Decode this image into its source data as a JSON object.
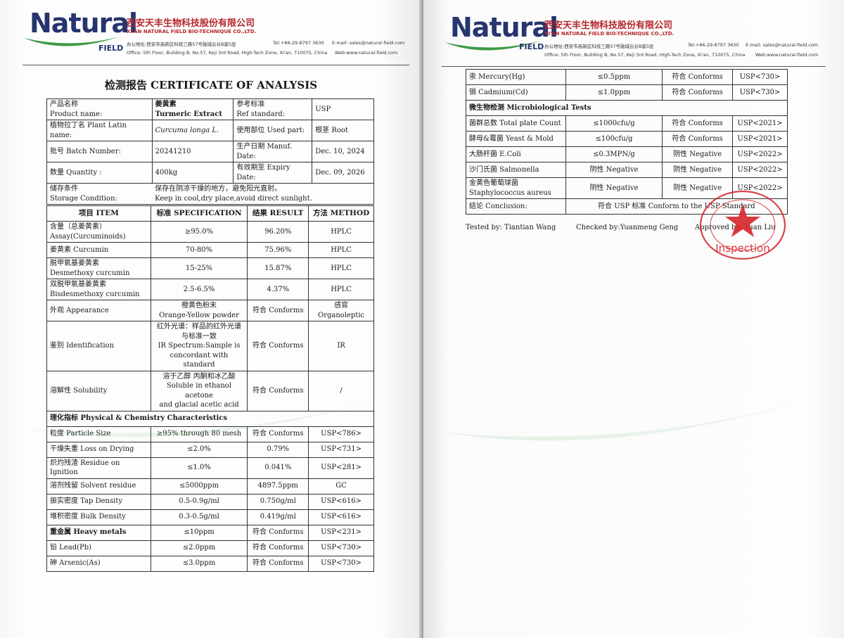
{
  "header": {
    "logo_text": "Natural",
    "logo_sub": "FIELD",
    "company_cn": "西安天丰生物科技股份有限公司",
    "company_en": "XI'AN NATURAL FIELD BIO-TECHNIQUE CO.,LTD.",
    "address_cn": "办公地址:西安市高新区科技三路57号融城云谷B座5层",
    "tel": "Tel:+86-29-8797 3630",
    "email": "E-mail: sales@natural-field.com",
    "address_en": "Office: 5th Floor, Building B, No.57, Keji 3rd Road, High-Tech Zone, Xi'an, 710075, China",
    "web": "Web:www.natural-field.com"
  },
  "title": "检测报告 CERTIFICATE OF ANALYSIS",
  "info": {
    "product_name_cn": "产品名称",
    "product_name_en": "Product name:",
    "product_value_cn": "姜黄素",
    "product_value_en": "Turmeric Extract",
    "ref_cn": "参考标准",
    "ref_en": "Ref standard:",
    "ref_value": "USP",
    "latin_label": "植物拉丁名 Plant Latin name:",
    "latin_value": "Curcuma longa L.",
    "part_label": "使用部位 Used part:",
    "part_value": "根茎 Root",
    "batch_label": "批号 Batch Number:",
    "batch_value": "20241210",
    "manuf_label": "生产日期 Manuf. Date:",
    "manuf_value": "Dec. 10, 2024",
    "qty_label": "数量 Quantity :",
    "qty_value": "400kg",
    "expiry_label": "有效期至 Expiry Date:",
    "expiry_value": "Dec. 09, 2026",
    "storage_cn": "储存条件",
    "storage_en": "Storage Condition:",
    "storage_value_cn": "保存在阴凉干燥的地方，避免阳光直射。",
    "storage_value_en": "Keep in cool,dry place,avoid direct sunlight."
  },
  "results_header": [
    "项目 ITEM",
    "标准 SPECIFICATION",
    "结果 RESULT",
    "方法 METHOD"
  ],
  "results": [
    {
      "item": [
        "含量（总姜黄素）",
        "Assay(Curcuminoids)"
      ],
      "spec": [
        "≥95.0%"
      ],
      "result": "96.20%",
      "method": "HPLC"
    },
    {
      "item": [
        "姜黄素 Curcumin"
      ],
      "spec": [
        "70-80%"
      ],
      "result": "75.96%",
      "method": "HPLC"
    },
    {
      "item": [
        "脱甲氧基姜黄素",
        "Desmethoxy curcumin"
      ],
      "spec": [
        "15-25%"
      ],
      "result": "15.87%",
      "method": "HPLC"
    },
    {
      "item": [
        "双脱甲氧基姜黄素",
        "Bisdesmethoxy curcumin"
      ],
      "spec": [
        "2.5-6.5%"
      ],
      "result": "4.37%",
      "method": "HPLC"
    },
    {
      "item": [
        "外观 Appearance"
      ],
      "spec": [
        "橙黄色粉末",
        "Orange-Yellow powder"
      ],
      "result": "符合 Conforms",
      "method": "感官 Organoleptic"
    },
    {
      "item": [
        "鉴别 Identification"
      ],
      "spec": [
        "红外光谱：样品的红外光谱",
        "与标准一致",
        "IR Spectrum:Sample is",
        "concordant with standard"
      ],
      "result": "符合 Conforms",
      "method": "IR"
    },
    {
      "item": [
        "溶解性 Solubility"
      ],
      "spec": [
        "溶于乙醇 丙酮和冰乙酸",
        "Soluble in ethanol acetone",
        "and glacial acetic acid"
      ],
      "result": "符合 Conforms",
      "method": "/"
    }
  ],
  "phys_section": "理化指标 Physical & Chemistry Characteristics",
  "phys": [
    {
      "item": "粒度 Particle Size",
      "spec": "≥95% through 80 mesh",
      "result": "符合 Conforms",
      "method": "USP<786>"
    },
    {
      "item": "干燥失重 Loss on Drying",
      "spec": "≤2.0%",
      "result": "0.79%",
      "method": "USP<731>"
    },
    {
      "item": "炽灼残渣 Residue on Ignition",
      "spec": "≤1.0%",
      "result": "0.041%",
      "method": "USP<281>"
    },
    {
      "item": "溶剂残留 Solvent residue",
      "spec": "≤5000ppm",
      "result": "4897.5ppm",
      "method": "GC"
    },
    {
      "item": "振实密度 Tap Density",
      "spec": "0.5-0.9g/ml",
      "result": "0.750g/ml",
      "method": "USP<616>"
    },
    {
      "item": "堆积密度 Bulk Density",
      "spec": "0.3-0.5g/ml",
      "result": "0.419g/ml",
      "method": "USP<616>"
    },
    {
      "item": "重金属 Heavy metals",
      "spec": "≤10ppm",
      "result": "符合 Conforms",
      "method": "USP<231>"
    },
    {
      "item": "铅 Lead(Pb)",
      "spec": "≤2.0ppm",
      "result": "符合 Conforms",
      "method": "USP<730>"
    },
    {
      "item": "砷 Arsenic(As)",
      "spec": "≤3.0ppm",
      "result": "符合 Conforms",
      "method": "USP<730>"
    }
  ],
  "right_rows": [
    {
      "item": "汞 Mercury(Hg)",
      "spec": "≤0.5ppm",
      "result": "符合 Conforms",
      "method": "USP<730>"
    },
    {
      "item": "镉 Cadmium(Cd)",
      "spec": "≤1.0ppm",
      "result": "符合 Conforms",
      "method": "USP<730>"
    }
  ],
  "micro_section": "微生物检测 Microbiological Tests",
  "micro": [
    {
      "item": [
        "菌群总数 Total plate Count"
      ],
      "spec": "≤1000cfu/g",
      "result": "符合 Conforms",
      "method": "USP<2021>"
    },
    {
      "item": [
        "酵母&霉菌 Yeast & Mold"
      ],
      "spec": "≤100cfu/g",
      "result": "符合 Conforms",
      "method": "USP<2021>"
    },
    {
      "item": [
        "大肠杆菌 E.Coli"
      ],
      "spec": "≤0.3MPN/g",
      "result": "阴性 Negative",
      "method": "USP<2022>"
    },
    {
      "item": [
        "沙门氏菌 Salmonella"
      ],
      "spec": "阴性 Negative",
      "result": "阴性 Negative",
      "method": "USP<2022>"
    },
    {
      "item": [
        "金黄色葡萄球菌",
        "Staphylococcus aureus"
      ],
      "spec": "阴性 Negative",
      "result": "阴性 Negative",
      "method": "USP<2022>"
    }
  ],
  "conclusion_label": "结论 Conclusion:",
  "conclusion_value": "符合 USP 标准 Conform to the USP Standard",
  "signatures": {
    "tested": "Tested by: Tiantian Wang",
    "checked": "Checked by:Yuanmeng Geng",
    "approved": "Approved by: Yuan Liu"
  },
  "stamp": {
    "text": "Inspection",
    "ring": "Xi'an Natural Field Bio-technique Company Limited",
    "color": "#d6232a"
  }
}
